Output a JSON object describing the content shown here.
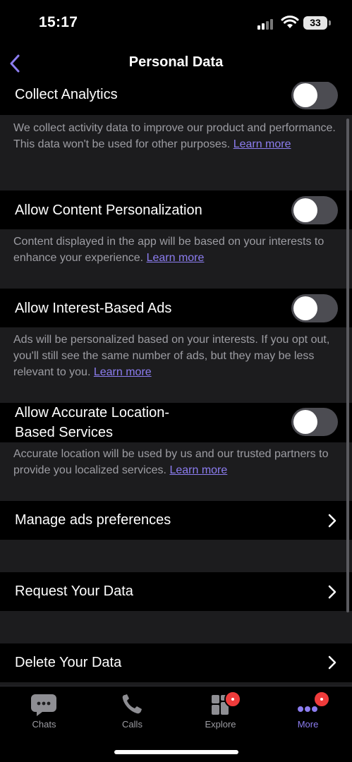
{
  "status_bar": {
    "time": "15:17",
    "battery": "33"
  },
  "nav": {
    "title": "Personal Data",
    "back_icon": "chevron-left-icon"
  },
  "settings": {
    "collect_analytics": {
      "label": "Collect Analytics",
      "enabled": false,
      "description": "We collect activity data to improve our product and performance. This data won't be used for other purposes.",
      "link": "Learn more"
    },
    "content_personalization": {
      "label": "Allow Content Personalization",
      "enabled": false,
      "description": "Content displayed in the app will be based on your interests to enhance your experience.",
      "link": "Learn more"
    },
    "interest_ads": {
      "label": "Allow Interest-Based Ads",
      "enabled": false,
      "description": "Ads will be personalized based on your interests. If you opt out, you'll still see the same number of ads, but they may be less relevant to you.",
      "link": "Learn more"
    },
    "location_services": {
      "label_line1": "Allow Accurate Location-",
      "label_line2": "Based Services",
      "enabled": false,
      "description": "Accurate location will be used by us and our trusted partners to provide you localized services.",
      "link": "Learn more"
    }
  },
  "links": {
    "manage_ads": "Manage ads preferences",
    "request_data": "Request Your Data",
    "delete_data": "Delete Your Data"
  },
  "tab_bar": {
    "tabs": [
      {
        "label": "Chats",
        "icon": "chat-bubble-icon",
        "active": false,
        "badge": false
      },
      {
        "label": "Calls",
        "icon": "phone-icon",
        "active": false,
        "badge": false
      },
      {
        "label": "Explore",
        "icon": "explore-grid-icon",
        "active": false,
        "badge": true
      },
      {
        "label": "More",
        "icon": "more-dots-icon",
        "active": true,
        "badge": true
      }
    ]
  },
  "colors": {
    "accent": "#8c7df0",
    "background": "#000000",
    "section_gap": "#1c1c1e",
    "secondary_text": "#9d9da3",
    "toggle_off": "#4c4c52",
    "badge": "#ef3b3b"
  }
}
